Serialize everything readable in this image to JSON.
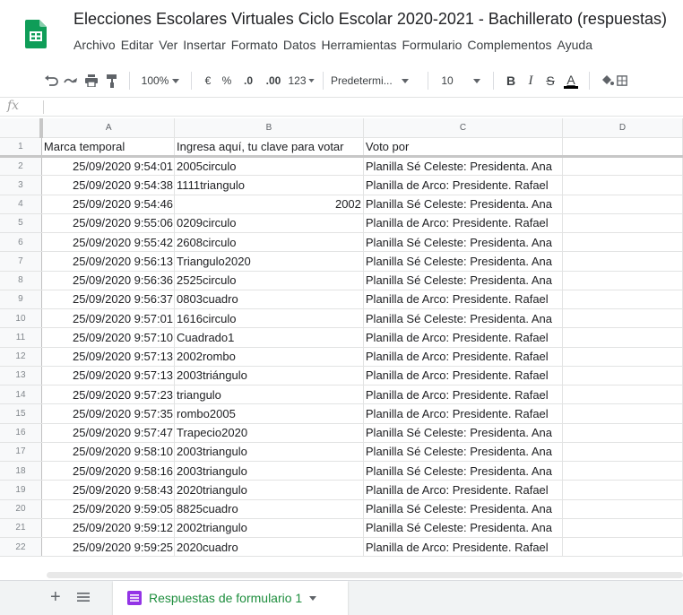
{
  "doc": {
    "title": "Elecciones Escolares Virtuales Ciclo Escolar 2020-2021 - Bachillerato (respuestas)",
    "menu": [
      "Archivo",
      "Editar",
      "Ver",
      "Insertar",
      "Formato",
      "Datos",
      "Herramientas",
      "Formulario",
      "Complementos",
      "Ayuda"
    ]
  },
  "toolbar": {
    "zoom": "100%",
    "currency": "€",
    "percent": "%",
    "dec_decrease": ".0",
    "dec_increase": ".00",
    "number_format": "123",
    "font": "Predetermi...",
    "font_size": "10",
    "bold": "B",
    "italic": "I",
    "strike": "S",
    "text_color": "A"
  },
  "formula_bar": {
    "fx": "fx",
    "value": ""
  },
  "columns": [
    "A",
    "B",
    "C",
    "D"
  ],
  "header_row": {
    "num": "1",
    "a": "Marca temporal",
    "b": "Ingresa aquí, tu clave para votar",
    "c": "Voto por",
    "d": ""
  },
  "rows": [
    {
      "num": "2",
      "a": "25/09/2020 9:54:01",
      "b": "2005circulo",
      "b_numeric": false,
      "c": "Planilla Sé Celeste: Presidenta. Ana"
    },
    {
      "num": "3",
      "a": "25/09/2020 9:54:38",
      "b": "1111triangulo",
      "b_numeric": false,
      "c": "Planilla de Arco: Presidente. Rafael"
    },
    {
      "num": "4",
      "a": "25/09/2020 9:54:46",
      "b": "2002",
      "b_numeric": true,
      "c": "Planilla Sé Celeste: Presidenta. Ana"
    },
    {
      "num": "5",
      "a": "25/09/2020 9:55:06",
      "b": "0209circulo",
      "b_numeric": false,
      "c": "Planilla de Arco: Presidente. Rafael"
    },
    {
      "num": "6",
      "a": "25/09/2020 9:55:42",
      "b": "2608circulo",
      "b_numeric": false,
      "c": "Planilla Sé Celeste: Presidenta. Ana"
    },
    {
      "num": "7",
      "a": "25/09/2020 9:56:13",
      "b": "Triangulo2020",
      "b_numeric": false,
      "c": "Planilla Sé Celeste: Presidenta. Ana"
    },
    {
      "num": "8",
      "a": "25/09/2020 9:56:36",
      "b": "2525circulo",
      "b_numeric": false,
      "c": "Planilla Sé Celeste: Presidenta. Ana"
    },
    {
      "num": "9",
      "a": "25/09/2020 9:56:37",
      "b": "0803cuadro",
      "b_numeric": false,
      "c": "Planilla de Arco: Presidente. Rafael"
    },
    {
      "num": "10",
      "a": "25/09/2020 9:57:01",
      "b": "1616circulo",
      "b_numeric": false,
      "c": "Planilla Sé Celeste: Presidenta. Ana"
    },
    {
      "num": "11",
      "a": "25/09/2020 9:57:10",
      "b": "Cuadrado1",
      "b_numeric": false,
      "c": "Planilla de Arco: Presidente. Rafael"
    },
    {
      "num": "12",
      "a": "25/09/2020 9:57:13",
      "b": "2002rombo",
      "b_numeric": false,
      "c": "Planilla de Arco: Presidente. Rafael"
    },
    {
      "num": "13",
      "a": "25/09/2020 9:57:13",
      "b": "2003triángulo",
      "b_numeric": false,
      "c": "Planilla de Arco: Presidente. Rafael"
    },
    {
      "num": "14",
      "a": "25/09/2020 9:57:23",
      "b": "triangulo",
      "b_numeric": false,
      "c": "Planilla de Arco: Presidente. Rafael"
    },
    {
      "num": "15",
      "a": "25/09/2020 9:57:35",
      "b": "rombo2005",
      "b_numeric": false,
      "c": "Planilla de Arco: Presidente. Rafael"
    },
    {
      "num": "16",
      "a": "25/09/2020 9:57:47",
      "b": "Trapecio2020",
      "b_numeric": false,
      "c": "Planilla Sé Celeste: Presidenta. Ana"
    },
    {
      "num": "17",
      "a": "25/09/2020 9:58:10",
      "b": "2003triangulo",
      "b_numeric": false,
      "c": "Planilla Sé Celeste: Presidenta. Ana"
    },
    {
      "num": "18",
      "a": "25/09/2020 9:58:16",
      "b": "2003triangulo",
      "b_numeric": false,
      "c": "Planilla Sé Celeste: Presidenta. Ana"
    },
    {
      "num": "19",
      "a": "25/09/2020 9:58:43",
      "b": "2020triangulo",
      "b_numeric": false,
      "c": "Planilla de Arco: Presidente. Rafael"
    },
    {
      "num": "20",
      "a": "25/09/2020 9:59:05",
      "b": "8825cuadro",
      "b_numeric": false,
      "c": "Planilla Sé Celeste: Presidenta. Ana"
    },
    {
      "num": "21",
      "a": "25/09/2020 9:59:12",
      "b": "2002triangulo",
      "b_numeric": false,
      "c": "Planilla Sé Celeste: Presidenta. Ana"
    },
    {
      "num": "22",
      "a": "25/09/2020 9:59:25",
      "b": "2020cuadro",
      "b_numeric": false,
      "c": "Planilla de Arco: Presidente. Rafael"
    }
  ],
  "sheet_tab": {
    "label": "Respuestas de formulario 1"
  },
  "colors": {
    "brand": "#0f9d58",
    "tab_text": "#1e8e3e",
    "forms_icon": "#9334e6"
  },
  "icons": {
    "logo": "google-sheets-logo",
    "undo": "undo-icon",
    "redo": "redo-icon",
    "print": "print-icon",
    "paint_format": "paint-format-icon",
    "fill": "fill-color-icon",
    "add_sheet": "plus-icon",
    "all_sheets": "list-icon",
    "tab_dropdown": "caret-down-icon"
  }
}
